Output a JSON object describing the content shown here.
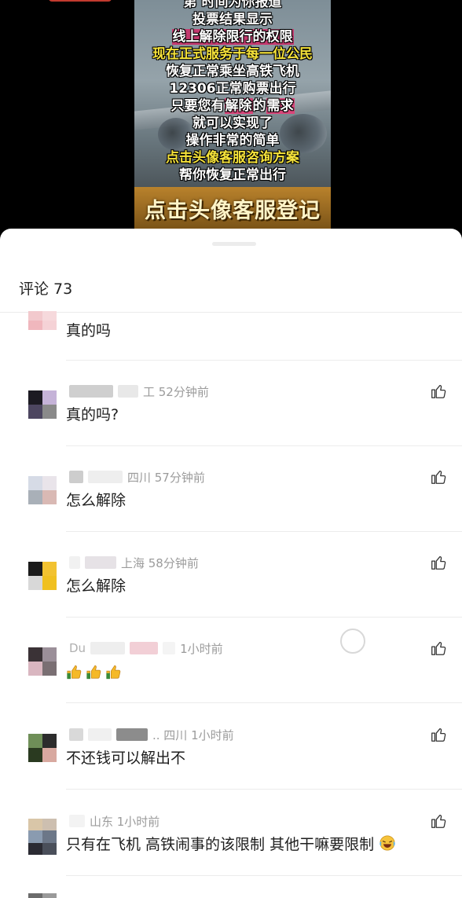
{
  "video": {
    "partial_top_line": "第   时间为你报道",
    "overlay_lines": [
      {
        "text": "投票结果显示",
        "style": "white"
      },
      {
        "text": "线上解除限行的权限",
        "style": "pink"
      },
      {
        "text": "现在正式服务于每一位公民",
        "style": "yellow"
      },
      {
        "text": "恢复正常乘坐高铁飞机",
        "style": "white"
      },
      {
        "text": "12306正常购票出行",
        "style": "white"
      },
      {
        "pre": "只要您有",
        "hl1": "解除",
        "mid": "的",
        "hl2": "需求",
        "style": "mixed"
      },
      {
        "text": "就可以实现了",
        "style": "white"
      },
      {
        "text": "操作非常的简单",
        "style": "white"
      },
      {
        "text": "点击头像客服咨询方案",
        "style": "yellow"
      },
      {
        "text": "帮你恢复正常出行",
        "style": "white"
      }
    ],
    "cta": "点击头像客服登记"
  },
  "comments_header": {
    "title": "评论 73"
  },
  "comments": [
    {
      "meta": "",
      "text": "真的吗",
      "avatar_colors": [
        "#f2c9cd",
        "#f6d9dc",
        "#f0b7bd",
        "#f5d2d6"
      ],
      "like_icon": "thumbs-up-icon"
    },
    {
      "meta": "工 52分钟前",
      "text": "真的吗?",
      "avatar_colors": [
        "#1c1a22",
        "#c5b3d8",
        "#4d4660",
        "#8a8a8a"
      ],
      "like_icon": "thumbs-up-icon"
    },
    {
      "meta": "四川 57分钟前",
      "text": "怎么解除",
      "avatar_colors": [
        "#d6dbe6",
        "#e9e4ea",
        "#a9b0b8",
        "#d9b9b4"
      ],
      "like_icon": "thumbs-up-icon"
    },
    {
      "meta": "上海 58分钟前",
      "text": "怎么解除",
      "avatar_colors": [
        "#1b1b1b",
        "#f2c230",
        "#d8d8d8",
        "#f0c020"
      ],
      "like_icon": "thumbs-up-icon"
    },
    {
      "meta": "1小时前",
      "meta_prefix": "Du",
      "text": "",
      "emojis": [
        "thumbs-up-emoji",
        "thumbs-up-emoji",
        "thumbs-up-emoji"
      ],
      "avatar_colors": [
        "#3a3236",
        "#9b8f99",
        "#d9b6c0",
        "#7a6f73"
      ],
      "like_icon": "thumbs-up-icon"
    },
    {
      "meta": ".. 四川 1小时前",
      "text": "不还钱可以解出不",
      "avatar_colors": [
        "#6f8f58",
        "#2c2c2c",
        "#2a3a20",
        "#d8a9a0"
      ],
      "like_icon": "thumbs-up-icon"
    },
    {
      "meta": "山东 1小时前",
      "text": "只有在飞机 高铁闹事的该限制 其他干嘛要限制",
      "trailing_emoji": "laughing-emoji",
      "avatar_colors": [
        "#d9c6a8",
        "#8a9bb0",
        "#2b2b33",
        "#6c7788"
      ],
      "like_icon": "thumbs-up-icon"
    }
  ],
  "colors": {
    "sheet_bg": "#ffffff",
    "meta_text": "#9b9b9b",
    "comment_text": "#1e1e1e",
    "overlay_yellow": "#f6e33a",
    "overlay_pink_highlight": "#d9467a",
    "cta_text": "#fff4c8"
  }
}
